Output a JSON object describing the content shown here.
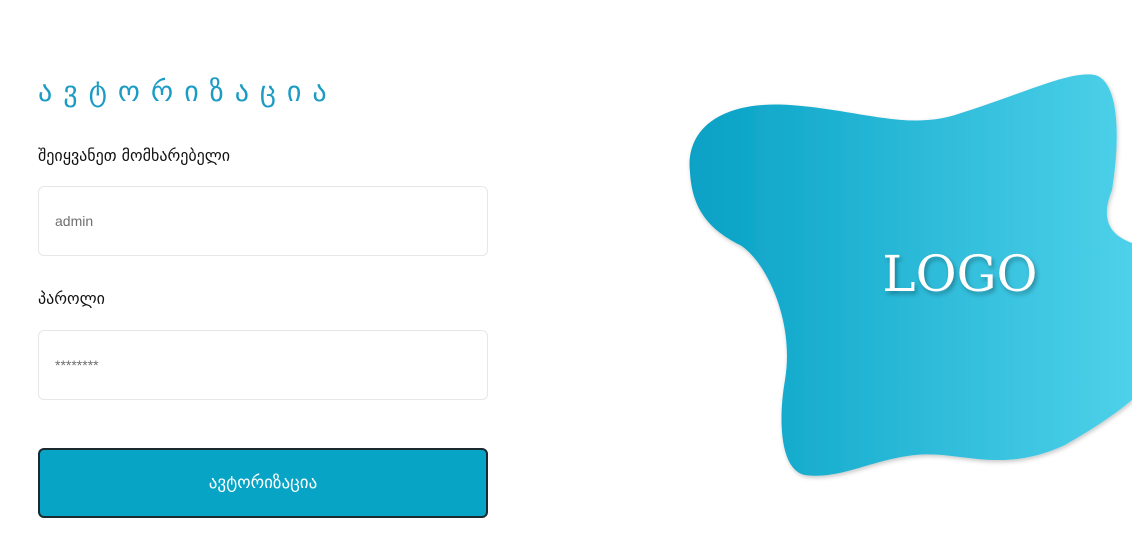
{
  "login": {
    "title": "ავტორიზაცია",
    "username_label": "შეიყვანეთ მომხარებელი",
    "username_placeholder": "admin",
    "password_label": "პაროლი",
    "password_placeholder": "********",
    "submit_label": "ავტორიზაცია"
  },
  "logo": {
    "text": "LOGO",
    "blob_color_start": "#07a1c5",
    "blob_color_end": "#4ed1ea"
  },
  "colors": {
    "accent": "#1c9cc4",
    "button_bg": "#08a4c5",
    "button_border": "#1b2a30",
    "field_border": "#e7e7e7"
  }
}
